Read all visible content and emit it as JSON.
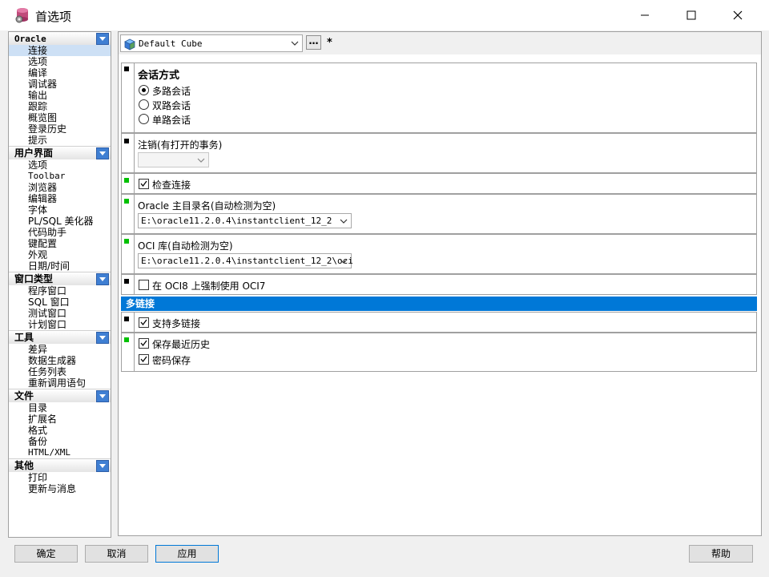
{
  "window": {
    "title": "首选项",
    "icons": {
      "app": "database-gear-icon",
      "minimize": "minimize-icon",
      "maximize": "maximize-icon",
      "close": "close-icon"
    }
  },
  "nav": {
    "oracle": {
      "title": "Oracle",
      "items": [
        "连接",
        "选项",
        "编译",
        "调试器",
        "输出",
        "跟踪",
        "概览图",
        "登录历史",
        "提示"
      ]
    },
    "ui": {
      "title": "用户界面",
      "items": [
        "选项",
        "Toolbar",
        "浏览器",
        "编辑器",
        "字体",
        "PL/SQL 美化器",
        "代码助手",
        "键配置",
        "外观",
        "日期/时间"
      ]
    },
    "wintypes": {
      "title": "窗口类型",
      "items": [
        "程序窗口",
        "SQL 窗口",
        "测试窗口",
        "计划窗口"
      ]
    },
    "tools": {
      "title": "工具",
      "items": [
        "差异",
        "数据生成器",
        "任务列表",
        "重新调用语句"
      ]
    },
    "files": {
      "title": "文件",
      "items": [
        "目录",
        "扩展名",
        "格式",
        "备份",
        "HTML/XML"
      ]
    },
    "other": {
      "title": "其他",
      "items": [
        "打印",
        "更新与消息"
      ]
    },
    "selected": "连接"
  },
  "profile": {
    "value": "Default Cube",
    "ellipsis": "…",
    "modified": "*",
    "icon": "cube-profile-icon"
  },
  "session": {
    "title": "会话方式",
    "options": [
      "多路会话",
      "双路会话",
      "单路会话"
    ],
    "selected_index": 0
  },
  "logoff": {
    "label": "注销(有打开的事务)",
    "value": ""
  },
  "check_connection": {
    "label": "检查连接",
    "checked": true
  },
  "oracle_home": {
    "label": "Oracle 主目录名(自动检测为空)",
    "value": "E:\\oracle11.2.0.4\\instantclient_12_2"
  },
  "oci_lib": {
    "label": "OCI 库(自动检测为空)",
    "value": "E:\\oracle11.2.0.4\\instantclient_12_2\\oci"
  },
  "force_oci7": {
    "label": "在 OCI8 上强制使用 OCI7",
    "checked": false
  },
  "multi": {
    "header": "多链接",
    "support": {
      "label": "支持多链接",
      "checked": true
    },
    "save_history": {
      "label": "保存最近历史",
      "checked": true
    },
    "save_password": {
      "label": "密码保存",
      "checked": true
    }
  },
  "buttons": {
    "ok": "确定",
    "cancel": "取消",
    "apply": "应用",
    "help": "帮助"
  },
  "colors": {
    "accent": "#0078d7",
    "marker_changed": "#00c000",
    "marker_default": "#000000",
    "selection": "#cde0f5"
  }
}
